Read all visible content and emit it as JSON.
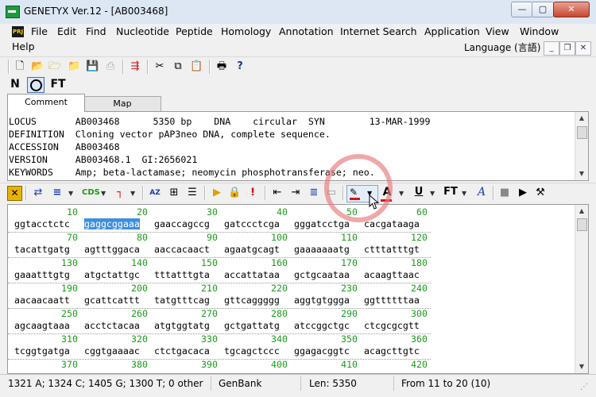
{
  "window": {
    "title": "GENETYX Ver.12 - [AB003468]",
    "minimize_glyph": "—",
    "maximize_glyph": "▢",
    "close_glyph": "✕"
  },
  "menu": {
    "app_icon_text": "PRJ",
    "items": [
      "File",
      "Edit",
      "Find",
      "Nucleotide",
      "Peptide",
      "Homology",
      "Annotation",
      "Internet Search",
      "Application",
      "View",
      "Window",
      "Help"
    ],
    "language": "Language (言語)"
  },
  "view_modes": {
    "n": "N",
    "ft": "FT"
  },
  "tabs": {
    "comment": "Comment",
    "map": "Map"
  },
  "comment_lines": [
    "LOCUS       AB003468      5350 bp    DNA    circular  SYN        13-MAR-1999",
    "DEFINITION  Cloning vector pAP3neo DNA, complete sequence.",
    "ACCESSION   AB003468",
    "VERSION     AB003468.1  GI:2656021",
    "KEYWORDS    Amp; beta-lactamase; neomycin phosphotransferase; neo."
  ],
  "sequence": {
    "rows": [
      {
        "numbers": [
          "10",
          "20",
          "30",
          "40",
          "50",
          "60"
        ],
        "blocks": [
          "ggtacctctc",
          "gaggcggaaa",
          "gaaccagccg",
          "gatccctcga",
          "gggatcctga",
          "cacgataaga"
        ]
      },
      {
        "numbers": [
          "70",
          "80",
          "90",
          "100",
          "110",
          "120"
        ],
        "blocks": [
          "tacattgatg",
          "agtttggaca",
          "aaccacaact",
          "agaatgcagt",
          "gaaaaaaatg",
          "ctttatttgt"
        ]
      },
      {
        "numbers": [
          "130",
          "140",
          "150",
          "160",
          "170",
          "180"
        ],
        "blocks": [
          "gaaatttgtg",
          "atgctattgc",
          "tttatttgta",
          "accattataa",
          "gctgcaataa",
          "acaagttaac"
        ]
      },
      {
        "numbers": [
          "190",
          "200",
          "210",
          "220",
          "230",
          "240"
        ],
        "blocks": [
          "aacaacaatt",
          "gcattcattt",
          "tatgtttcag",
          "gttcaggggg",
          "aggtgtggga",
          "ggttttttaa"
        ]
      },
      {
        "numbers": [
          "250",
          "260",
          "270",
          "280",
          "290",
          "300"
        ],
        "blocks": [
          "agcaagtaaa",
          "acctctacaa",
          "atgtggtatg",
          "gctgattatg",
          "atccggctgc",
          "ctcgcgcgtt"
        ]
      },
      {
        "numbers": [
          "310",
          "320",
          "330",
          "340",
          "350",
          "360"
        ],
        "blocks": [
          "tcggtgatga",
          "cggtgaaaac",
          "ctctgacaca",
          "tgcagctccc",
          "ggagacggtc",
          "acagcttgtc"
        ]
      },
      {
        "numbers": [
          "370",
          "380",
          "390",
          "400",
          "410",
          "420"
        ],
        "blocks": [
          "",
          "",
          "",
          "",
          "",
          ""
        ]
      }
    ]
  },
  "status": {
    "composition": "1321 A; 1324 C; 1405 G; 1300 T; 0 other",
    "format": "GenBank",
    "length": "Len: 5350",
    "selection": "From 11 to 20 (10)"
  },
  "colors": {
    "title_bar": "#dce7f3",
    "selection": "#3d8fe0",
    "ruler_numbers": "#1a9a1a",
    "highlight_ring": "#e87878"
  }
}
